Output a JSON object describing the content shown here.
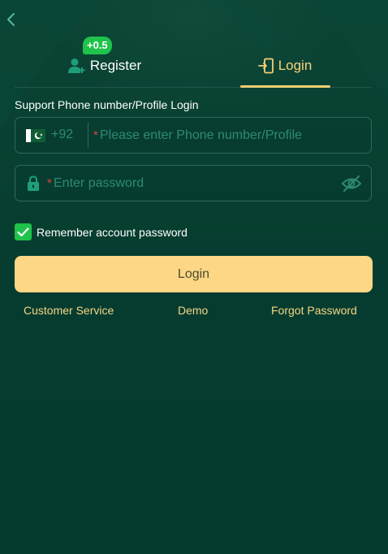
{
  "tabs": {
    "register_label": "Register",
    "login_label": "Login",
    "bonus_badge": "+0.5",
    "active": "login"
  },
  "form": {
    "support_label": "Support Phone number/Profile Login",
    "country_code": "+92",
    "country_flag": "pakistan-flag",
    "required_mark": "*",
    "phone_placeholder": "Please enter Phone number/Profile",
    "password_placeholder": "Enter password",
    "remember_label": "Remember account password",
    "remember_checked": true,
    "login_button": "Login"
  },
  "links": {
    "customer_service": "Customer Service",
    "demo": "Demo",
    "forgot_password": "Forgot Password"
  },
  "icons": {
    "back": "chevron-left-icon",
    "register": "user-plus-icon",
    "login": "login-door-icon",
    "lock": "lock-icon",
    "eye": "eye-off-icon",
    "check": "check-icon"
  },
  "colors": {
    "background": "#053a2e",
    "accent": "#f5cf73",
    "button": "#fdd785",
    "badge": "#1fc24a",
    "placeholder": "#2f8a72",
    "required": "#e1413d"
  }
}
